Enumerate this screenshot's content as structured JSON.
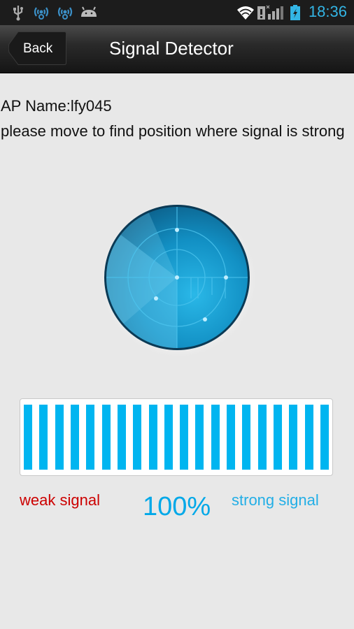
{
  "status_bar": {
    "left_icons": [
      "usb-icon",
      "wifi-hotspot-icon",
      "wifi-hotspot-icon",
      "android-icon"
    ],
    "right_icons": [
      "wifi-icon",
      "no-sim-icon",
      "cell-signal-icon",
      "battery-charging-icon"
    ],
    "time": "18:36"
  },
  "action_bar": {
    "back_label": "Back",
    "title": "Signal Detector"
  },
  "content": {
    "ap_name": "AP Name:lfy045",
    "hint": "please move to find position where signal is strong"
  },
  "signal": {
    "bar_count": 20,
    "filled_bars": 20,
    "percent_value": 100,
    "percent_label": "100%",
    "weak_label": "weak signal",
    "strong_label": "strong signal",
    "bar_color": "#00b5f0",
    "weak_color": "#cc0000",
    "strong_color": "#22aee6"
  }
}
